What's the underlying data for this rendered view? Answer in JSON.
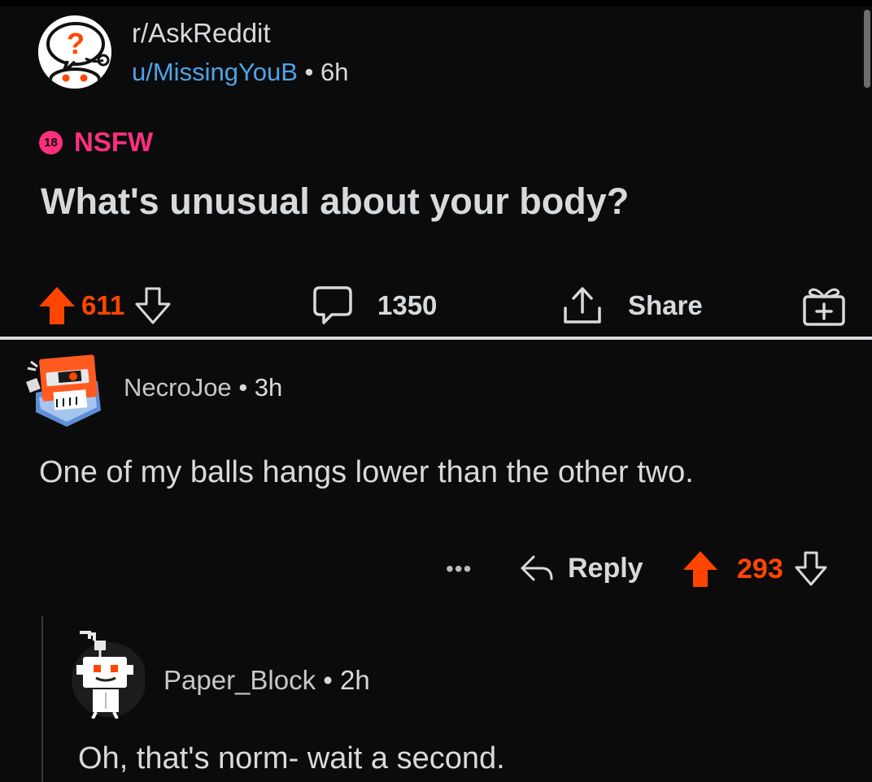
{
  "post": {
    "subreddit": "r/AskReddit",
    "author": "u/MissingYouB",
    "separator": "•",
    "age": "6h",
    "nsfw_badge": "18",
    "nsfw_label": "NSFW",
    "title": "What's unusual about your body?",
    "score": "611",
    "comment_count": "1350",
    "share_label": "Share"
  },
  "comment": {
    "author": "NecroJoe",
    "separator": "•",
    "age": "3h",
    "body": "One of my balls hangs lower than the other two.",
    "more_label": "•••",
    "reply_label": "Reply",
    "score": "293"
  },
  "reply": {
    "author": "Paper_Block",
    "separator": "•",
    "age": "2h",
    "body": "Oh, that's norm- wait a second."
  },
  "icons": {
    "upvote": "upvote-arrow-icon",
    "downvote": "downvote-arrow-icon",
    "comment": "speech-bubble-icon",
    "share": "share-upload-icon",
    "award": "gift-award-icon",
    "reply": "reply-arrow-icon"
  },
  "colors": {
    "upvote": "#ff4500",
    "nsfw": "#ff2f7e",
    "username_link": "#4fa3e6",
    "text": "#d7dadc",
    "background": "#0b0b0c"
  }
}
